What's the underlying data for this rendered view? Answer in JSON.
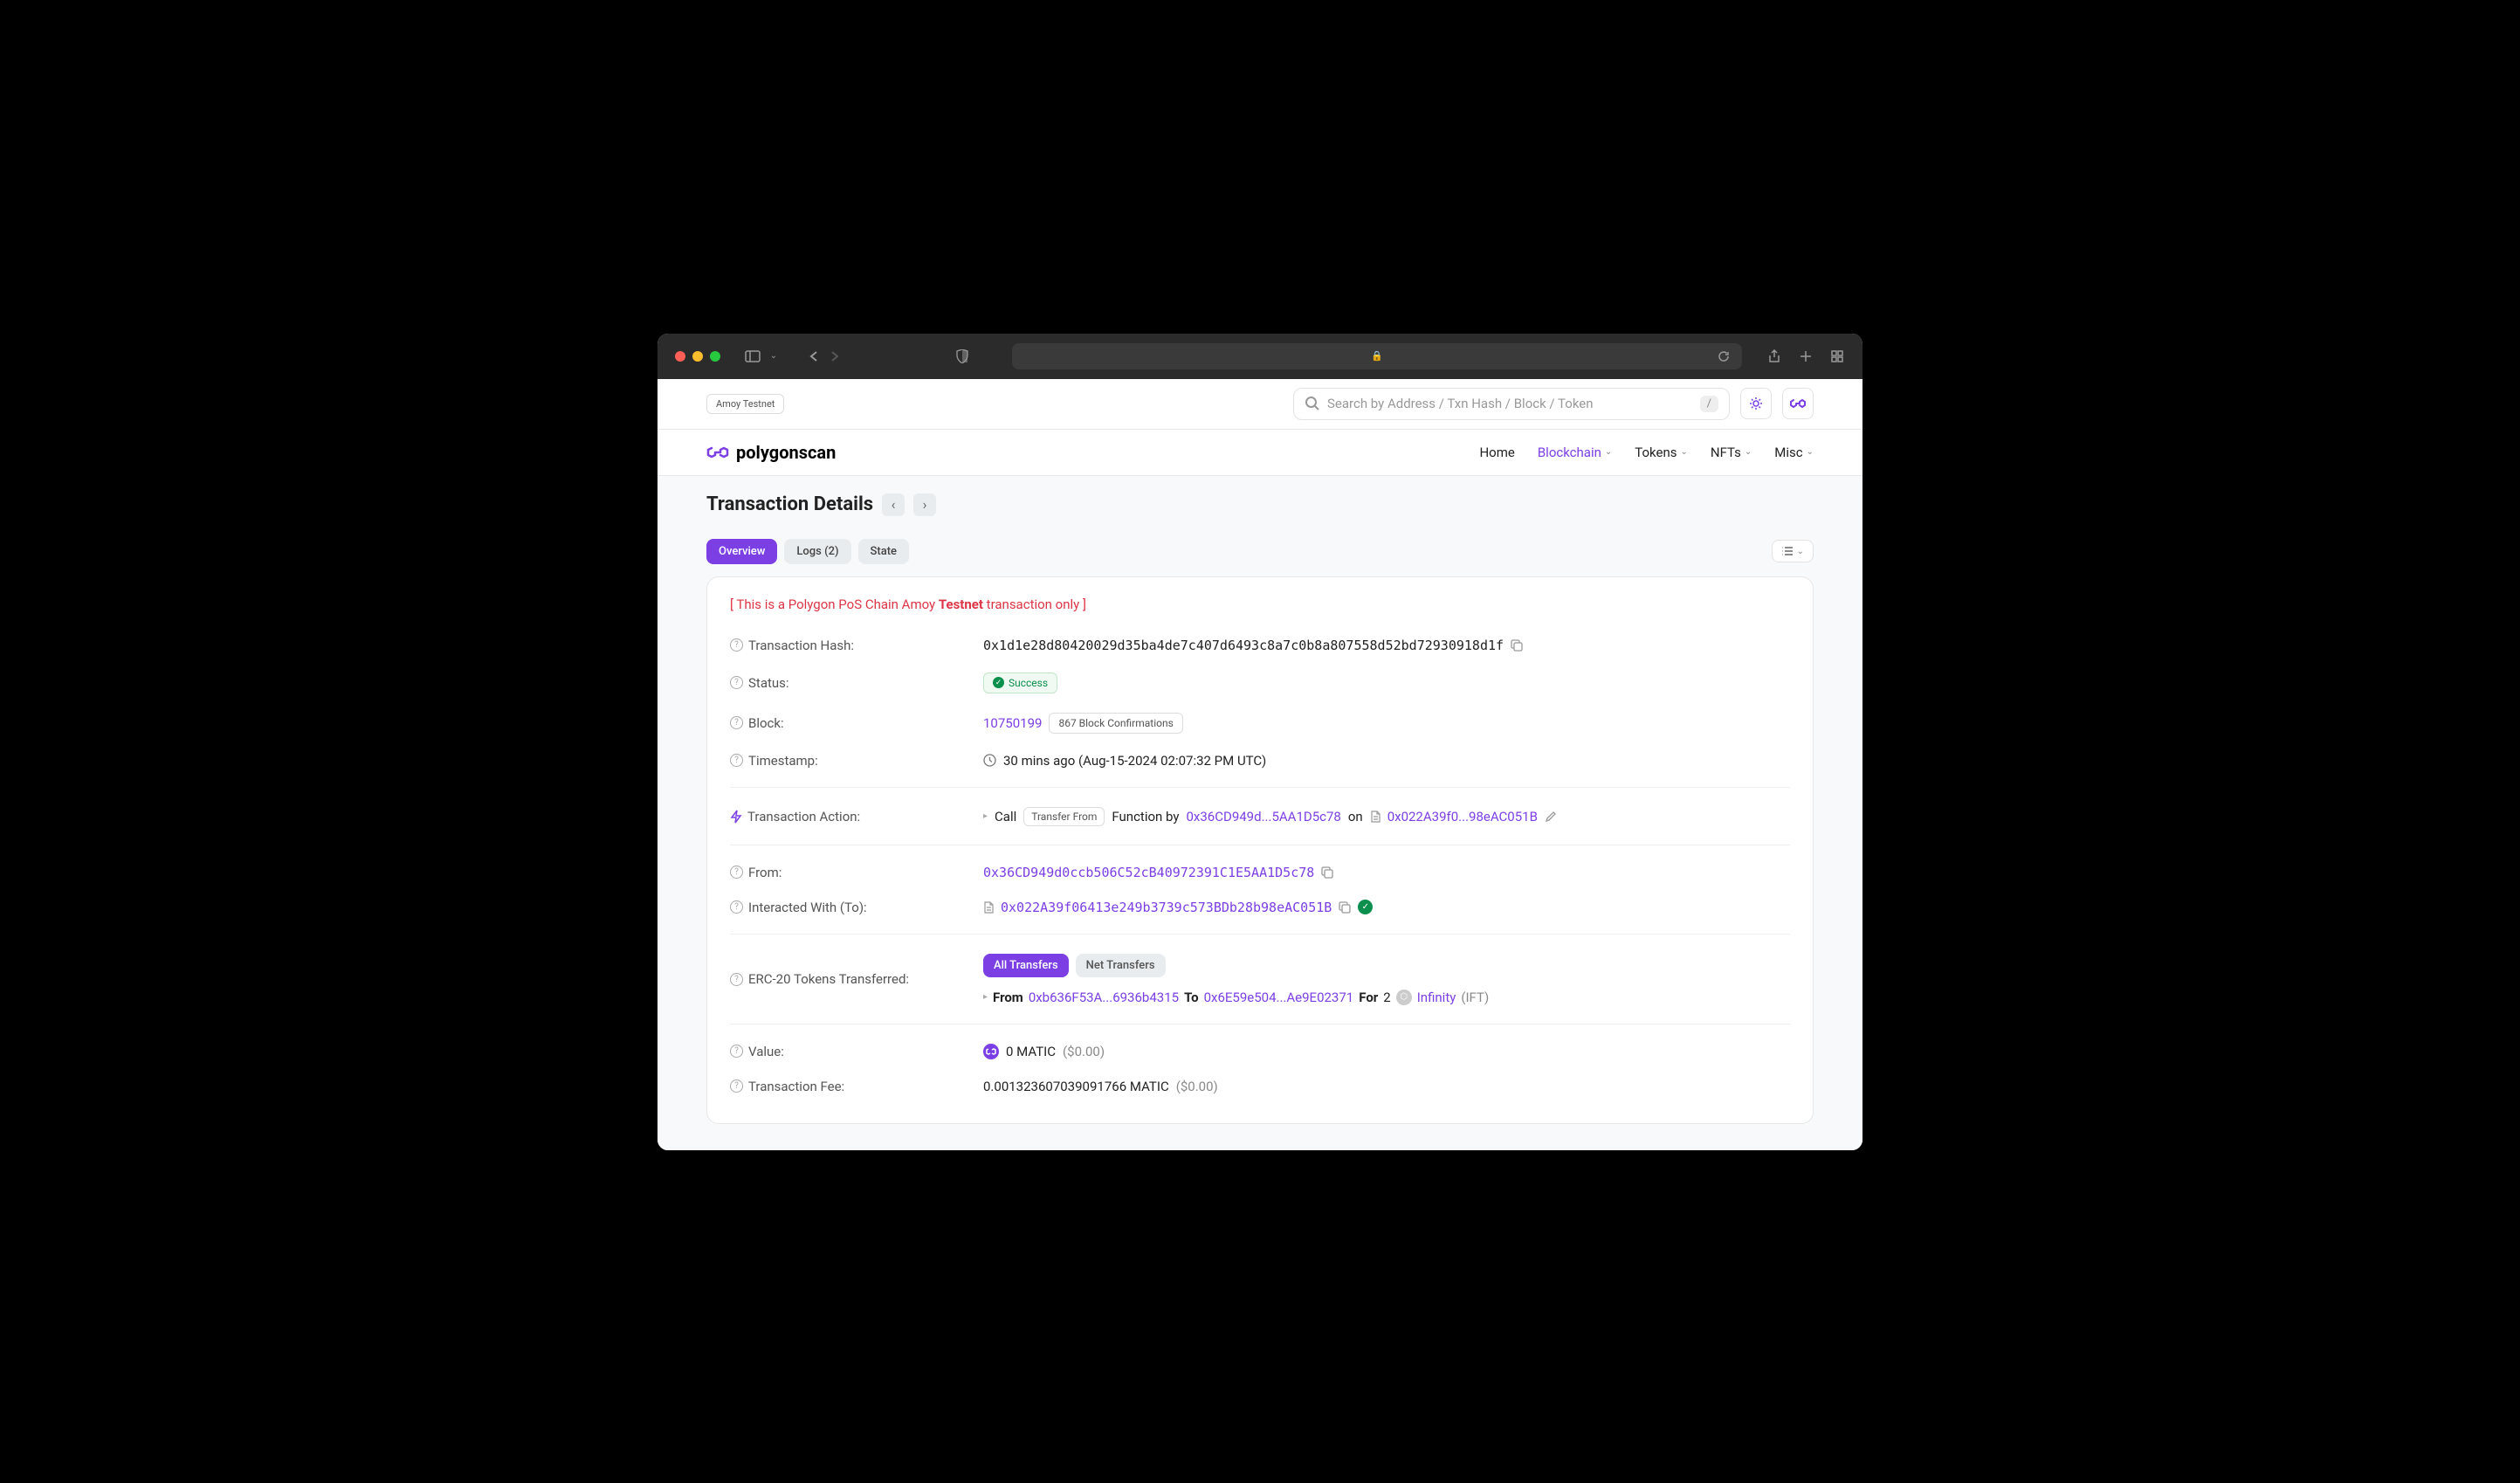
{
  "topstrip": {
    "network_badge": "Amoy Testnet",
    "search_placeholder": "Search by Address / Txn Hash / Block / Token",
    "kbd_hint": "/"
  },
  "navbar": {
    "brand": "polygonscan",
    "links": [
      "Home",
      "Blockchain",
      "Tokens",
      "NFTs",
      "Misc"
    ],
    "active_index": 1
  },
  "page": {
    "title": "Transaction Details",
    "tabs": [
      "Overview",
      "Logs (2)",
      "State"
    ],
    "active_tab": 0
  },
  "warning": {
    "prefix": "[ This is a Polygon PoS Chain Amoy ",
    "bold": "Testnet",
    "suffix": " transaction only ]"
  },
  "tx": {
    "hash_label": "Transaction Hash:",
    "hash": "0x1d1e28d80420029d35ba4de7c407d6493c8a7c0b8a807558d52bd72930918d1f",
    "status_label": "Status:",
    "status": "Success",
    "block_label": "Block:",
    "block": "10750199",
    "confirmations": "867 Block Confirmations",
    "timestamp_label": "Timestamp:",
    "timestamp": "30 mins ago (Aug-15-2024 02:07:32 PM UTC)",
    "action_label": "Transaction Action:",
    "action_call": "Call",
    "action_pill": "Transfer From",
    "action_by": "Function by",
    "action_addr1": "0x36CD949d...5AA1D5c78",
    "action_on": "on",
    "action_addr2": "0x022A39f0...98eAC051B",
    "from_label": "From:",
    "from": "0x36CD949d0ccb506C52cB40972391C1E5AA1D5c78",
    "to_label": "Interacted With (To):",
    "to": "0x022A39f06413e249b3739c573BDb28b98eAC051B",
    "erc20_label": "ERC-20 Tokens Transferred:",
    "transfer_tabs": [
      "All Transfers",
      "Net Transfers"
    ],
    "transfer_from_label": "From",
    "transfer_from": "0xb636F53A...6936b4315",
    "transfer_to_label": "To",
    "transfer_to": "0x6E59e504...Ae9E02371",
    "transfer_for": "For",
    "transfer_amount": "2",
    "transfer_token": "Infinity",
    "transfer_symbol": "(IFT)",
    "value_label": "Value:",
    "value_amount": "0 MATIC",
    "value_usd": "($0.00)",
    "fee_label": "Transaction Fee:",
    "fee_amount": "0.001323607039091766 MATIC",
    "fee_usd": "($0.00)"
  }
}
